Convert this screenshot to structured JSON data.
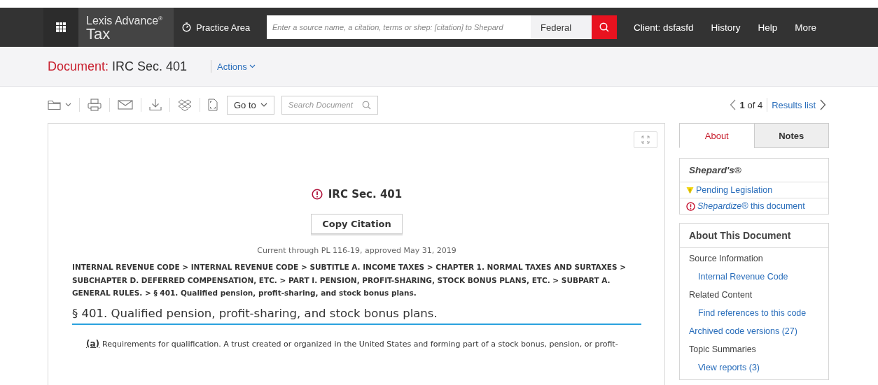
{
  "app": {
    "brand": "Lexis Advance$^{®}$",
    "product": "Tax"
  },
  "nav": {
    "practice_area": "Practice Area",
    "search": {
      "placeholder": "Enter a source name, a citation, terms or shep: [citation] to Shepard"
    },
    "jurisdiction": "Federal",
    "links": [
      "Client: dsfasfd",
      "History",
      "Help",
      "More"
    ]
  },
  "document_header": {
    "label": "Document:",
    "title": "IRC Sec. 401",
    "actions": "Actions"
  },
  "toolbar": {
    "goto": "Go to",
    "search": {
      "placeholder": "Search Document"
    }
  },
  "pager": {
    "position": "**1** of 4",
    "results": "Results list"
  },
  "document": {
    "title": "IRC Sec. 401",
    "copy_button": "Copy Citation",
    "currency": "Current through PL 116-19, approved May 31, 2019",
    "breadcrumb": "INTERNAL REVENUE CODE  > INTERNAL REVENUE CODE  > SUBTITLE A. INCOME TAXES > CHAPTER 1. NORMAL TAXES AND SURTAXES  > SUBCHAPTER D. DEFERRED COMPENSATION, ETC.  > PART I. PENSION, PROFIT-SHARING, STOCK BONUS PLANS, ETC.  > SUBPART A. GENERAL RULES.  > § 401. Qualified pension, profit-sharing, and stock bonus plans.",
    "heading": "§ 401. Qualified pension, profit-sharing, and stock bonus plans.",
    "paragraphs": [
      {
        "label": "(a)",
        "text": "Requirements for qualification. A trust created or organized in the United States and forming part of a stock bonus, pension, or profit-"
      }
    ]
  },
  "side_tabs": [
    {
      "label": "About",
      "selected": true
    },
    {
      "label": "Notes",
      "selected": false
    }
  ],
  "shepards": {
    "title": "Shepard's®",
    "items": [
      {
        "kind": "pending",
        "text": "Pending Legislation"
      },
      {
        "kind": "shepardize",
        "text": "*Shepardize®* this document"
      }
    ]
  },
  "about": {
    "title": "About This Document",
    "items": [
      {
        "kind": "heading",
        "text": "Source Information"
      },
      {
        "kind": "sublink",
        "text": "Internal Revenue Code"
      },
      {
        "kind": "heading",
        "text": "Related Content"
      },
      {
        "kind": "sublink",
        "text": "Find references to this code"
      },
      {
        "kind": "link",
        "text": "Archived code versions (27)"
      },
      {
        "kind": "heading",
        "text": "Topic Summaries"
      },
      {
        "kind": "sublink",
        "text": "View reports (3)"
      }
    ]
  }
}
